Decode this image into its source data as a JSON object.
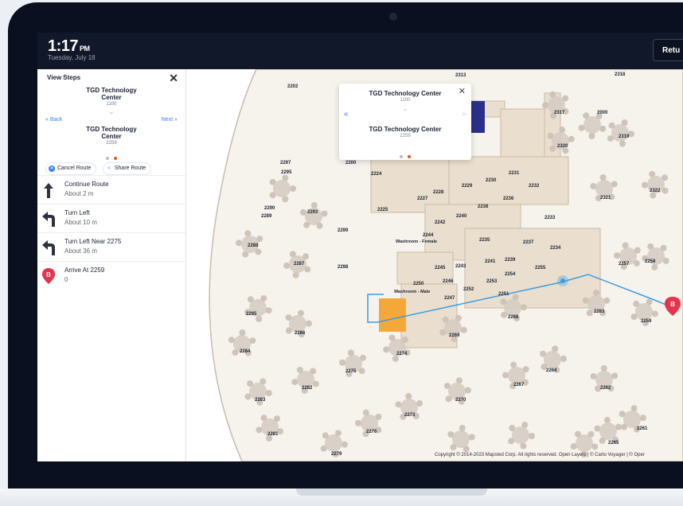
{
  "header": {
    "time": "1:17",
    "ampm": "PM",
    "date": "Tuesday, July 18",
    "return_label": "Retu"
  },
  "panel": {
    "title": "View Steps",
    "from": {
      "name": "TGD Technology Center",
      "number": "1100"
    },
    "to": {
      "name": "TGD Technology Center",
      "number": "2259"
    },
    "back_label": "Back",
    "next_label": "Next",
    "cancel_label": "Cancel Route",
    "share_label": "Share Route",
    "steps": [
      {
        "title": "Continue Route",
        "sub": "About 2 m",
        "icon": "arrow-up-icon"
      },
      {
        "title": "Turn Left",
        "sub": "About 10 m",
        "icon": "turn-left-icon"
      },
      {
        "title": "Turn Left Near 2275",
        "sub": "About 36 m",
        "icon": "turn-left-icon"
      },
      {
        "title": "Arrive At 2259",
        "sub": "0",
        "icon": "destination-marker-icon"
      }
    ]
  },
  "popup": {
    "from_name": "TGD Technology Center",
    "from_number": "1100",
    "to_name": "TGD Technology Center",
    "to_number": "2259"
  },
  "map": {
    "destination_marker": "B",
    "labels": [
      "2202",
      "2200",
      "2297",
      "2295",
      "2224",
      "2228",
      "2229",
      "2230",
      "2231",
      "2232",
      "2227",
      "2236",
      "2225",
      "2240",
      "2238",
      "2242",
      "2233",
      "2244",
      "2235",
      "2237",
      "2234",
      "2239",
      "2241",
      "2243",
      "2245",
      "2246",
      "2254",
      "2255",
      "2253",
      "2252",
      "2250",
      "2247",
      "2251",
      "2299",
      "2298",
      "2290",
      "2289",
      "2293",
      "2288",
      "2287",
      "2285",
      "2286",
      "2284",
      "2275",
      "2274",
      "2269",
      "2268",
      "2263",
      "2257",
      "2258",
      "2259",
      "2264",
      "2262",
      "2267",
      "2282",
      "2283",
      "2270",
      "2273",
      "2276",
      "2281",
      "2279",
      "2261",
      "2265",
      "2317",
      "2000",
      "2319",
      "2320",
      "2321",
      "2322",
      "2313",
      "2318",
      "Washroom - Female",
      "Washroom - Male"
    ],
    "copyright": "Copyright © 2014-2023 Mapsted Corp. All rights reserved.   Open Layers | © Carto Voyager | © Oper",
    "colors": {
      "route": "#3b9de1",
      "highlight": "#f5a83a",
      "marker": "#e5334b",
      "floor": "#eadfce",
      "desk": "#d6ccc3"
    }
  }
}
